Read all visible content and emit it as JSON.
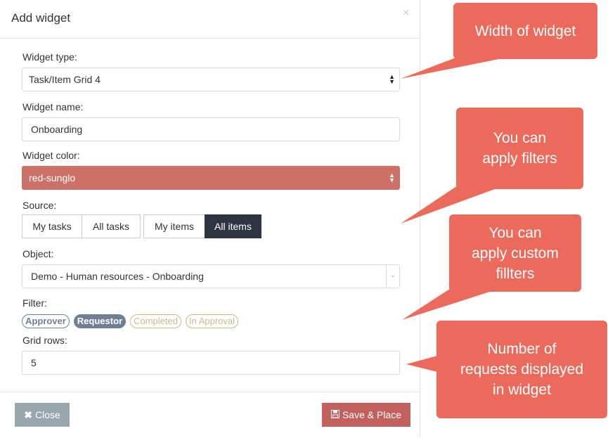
{
  "modal": {
    "title": "Add widget",
    "close_glyph": "×"
  },
  "form": {
    "widget_type_label": "Widget type:",
    "widget_type_value": "Task/Item Grid 4",
    "widget_name_label": "Widget name:",
    "widget_name_value": "Onboarding",
    "widget_color_label": "Widget color:",
    "widget_color_value": "red-sunglo",
    "source_label": "Source:",
    "source_options": [
      "My tasks",
      "All tasks",
      "My items",
      "All items"
    ],
    "source_selected": "All items",
    "object_label": "Object:",
    "object_value": "Demo - Human resources - Onboarding",
    "filter_label": "Filter:",
    "filters": [
      {
        "label": "Approver",
        "state": "outline"
      },
      {
        "label": "Requestor",
        "state": "filled"
      },
      {
        "label": "Completed",
        "state": "outline"
      },
      {
        "label": "In Approval",
        "state": "outline"
      }
    ],
    "grid_rows_label": "Grid rows:",
    "grid_rows_value": "5"
  },
  "footer": {
    "close_label": "Close",
    "close_icon": "times-icon",
    "save_label": "Save & Place",
    "save_icon": "floppy-disk-icon"
  },
  "callouts": [
    {
      "text": "Width of widget"
    },
    {
      "lines": [
        "You can",
        "apply filters"
      ]
    },
    {
      "lines": [
        "You can",
        "apply custom",
        "fillters"
      ]
    },
    {
      "lines": [
        "Number of",
        "requests displayed",
        "in widget"
      ]
    }
  ],
  "colors": {
    "accent_red": "#cc7068",
    "callout": "#ec6a5b",
    "active_segment": "#2e3440",
    "save_button": "#c2605e",
    "close_button": "#98a6ad"
  }
}
